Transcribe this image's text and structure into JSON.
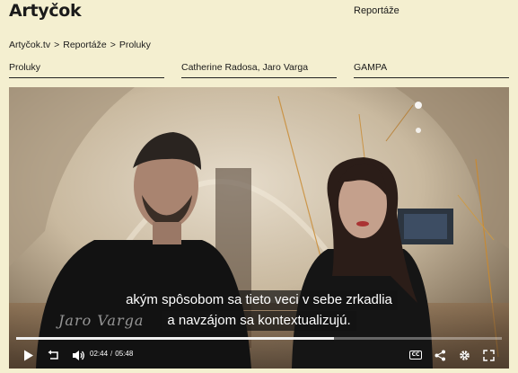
{
  "site": {
    "logo": "Artyčok"
  },
  "nav": {
    "reportaze": "Reportáže"
  },
  "breadcrumb": {
    "items": [
      "Artyčok.tv",
      "Reportáže",
      "Proluky"
    ],
    "separator": ">"
  },
  "meta": {
    "title": "Proluky",
    "authors": "Catherine Radosa, Jaro Varga",
    "venue": "GAMPA"
  },
  "player": {
    "subtitle_line1": "akým spôsobom sa tieto veci v sebe zrkadlia",
    "subtitle_line2": "a navzájom sa kontextualizujú.",
    "name_overlay": "Jaro Varga",
    "current_time": "02:44",
    "time_separator": "/",
    "duration": "05:48",
    "progress_fraction": 0.654,
    "cc_label": "CC",
    "icons": [
      "play-icon",
      "replay-10-icon",
      "volume-icon",
      "cc-icon",
      "share-icon",
      "settings-icon",
      "fullscreen-icon"
    ]
  },
  "colors": {
    "background": "#f4efd0",
    "text": "#1a1a1a",
    "controls": "#ffffff"
  }
}
